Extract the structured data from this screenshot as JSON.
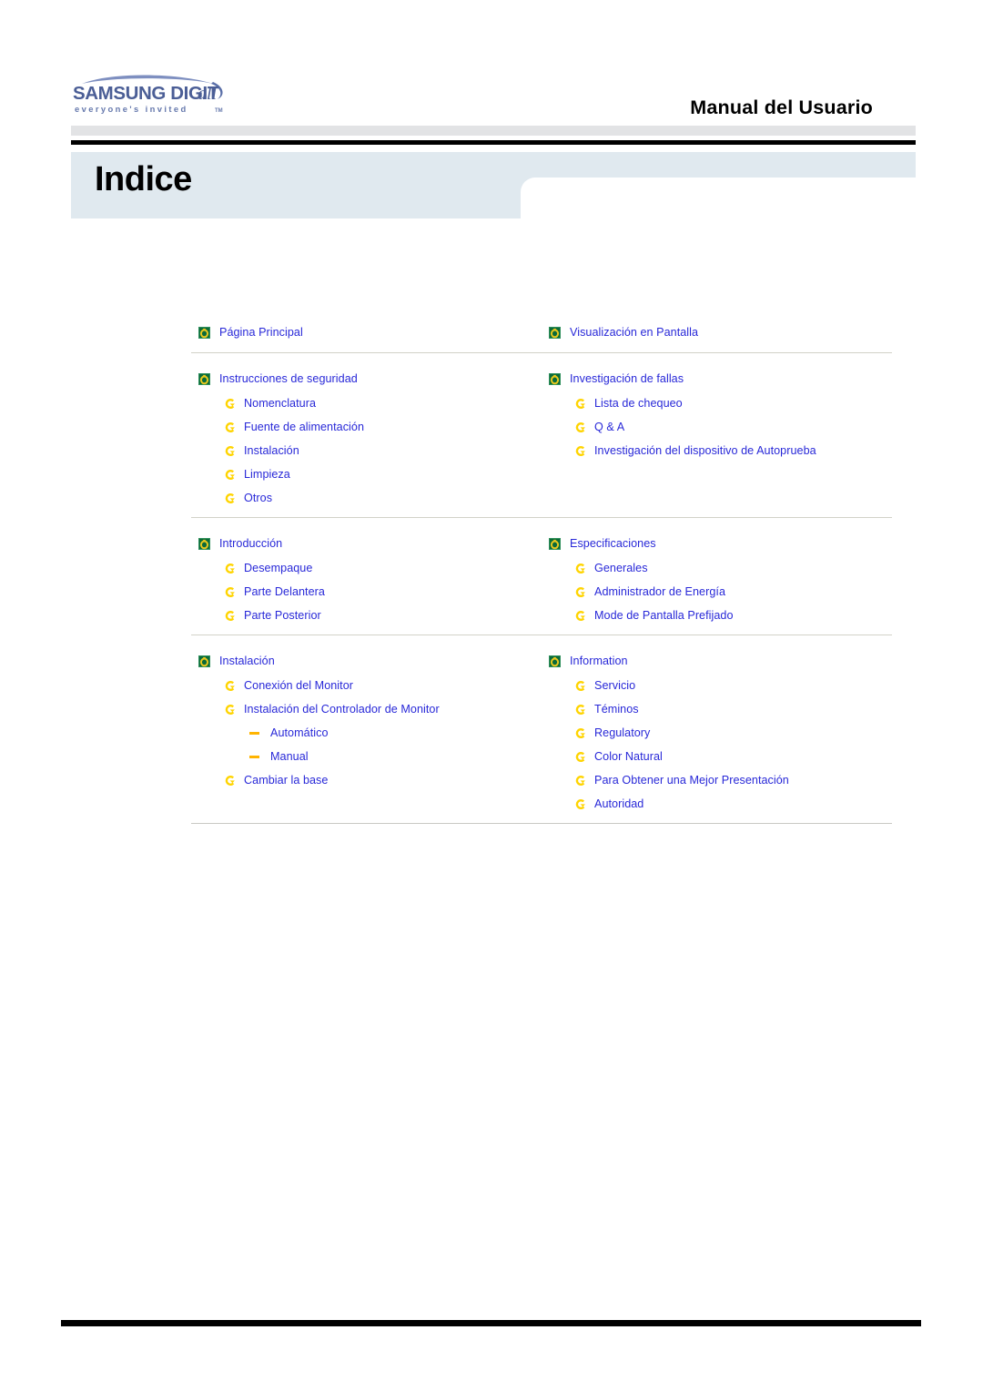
{
  "header": {
    "logo_primary": "SAMSUNG DIGITall",
    "logo_tagline": "everyone's invited",
    "logo_tagline_tm": "TM",
    "manual_title": "Manual del Usuario"
  },
  "page": {
    "title": "Indice"
  },
  "colors": {
    "link": "#2828d8",
    "tab_band": "#e0e9ef",
    "grey_band": "#e2e3e5",
    "rule_black": "#000000",
    "separator": "#d2d2c8",
    "icon_square_green": "#0b6b3a",
    "icon_ring_gold": "#e8c81e",
    "icon_arrow_gold": "#ffd400",
    "icon_dash_gold": "#ffb400",
    "logo_blue": "#5a6fa8"
  },
  "icons": {
    "level1": "green-square-ring-icon",
    "level2": "gold-arrow-circle-icon",
    "level3": "gold-dash-icon"
  },
  "index": {
    "groups": [
      {
        "left": {
          "title": "Página Principal",
          "children": []
        },
        "right": {
          "title": "Visualización en Pantalla",
          "children": []
        }
      },
      {
        "left": {
          "title": "Instrucciones de seguridad",
          "children": [
            {
              "label": "Nomenclatura",
              "level": 2
            },
            {
              "label": "Fuente de alimentación",
              "level": 2
            },
            {
              "label": "Instalación",
              "level": 2
            },
            {
              "label": "Limpieza",
              "level": 2
            },
            {
              "label": "Otros",
              "level": 2
            }
          ]
        },
        "right": {
          "title": "Investigación de fallas",
          "children": [
            {
              "label": "Lista de chequeo",
              "level": 2
            },
            {
              "label": "Q & A",
              "level": 2
            },
            {
              "label": "Investigación del dispositivo de Autoprueba",
              "level": 2
            }
          ]
        }
      },
      {
        "left": {
          "title": "Introducción",
          "children": [
            {
              "label": "Desempaque",
              "level": 2
            },
            {
              "label": "Parte Delantera",
              "level": 2
            },
            {
              "label": "Parte Posterior",
              "level": 2
            }
          ]
        },
        "right": {
          "title": "Especificaciones",
          "children": [
            {
              "label": "Generales",
              "level": 2
            },
            {
              "label": "Administrador de Energía",
              "level": 2
            },
            {
              "label": "Mode de Pantalla Prefijado",
              "level": 2
            }
          ]
        }
      },
      {
        "left": {
          "title": "Instalación",
          "children": [
            {
              "label": "Conexión del Monitor",
              "level": 2
            },
            {
              "label": "Instalación del Controlador de Monitor",
              "level": 2
            },
            {
              "label": "Automático",
              "level": 3
            },
            {
              "label": "Manual",
              "level": 3
            },
            {
              "label": "Cambiar la base",
              "level": 2
            }
          ]
        },
        "right": {
          "title": "Information",
          "children": [
            {
              "label": "Servicio",
              "level": 2
            },
            {
              "label": "Téminos",
              "level": 2
            },
            {
              "label": "Regulatory",
              "level": 2
            },
            {
              "label": "Color Natural",
              "level": 2
            },
            {
              "label": "Para Obtener una Mejor Presentación",
              "level": 2
            },
            {
              "label": "Autoridad",
              "level": 2
            }
          ]
        }
      }
    ]
  }
}
